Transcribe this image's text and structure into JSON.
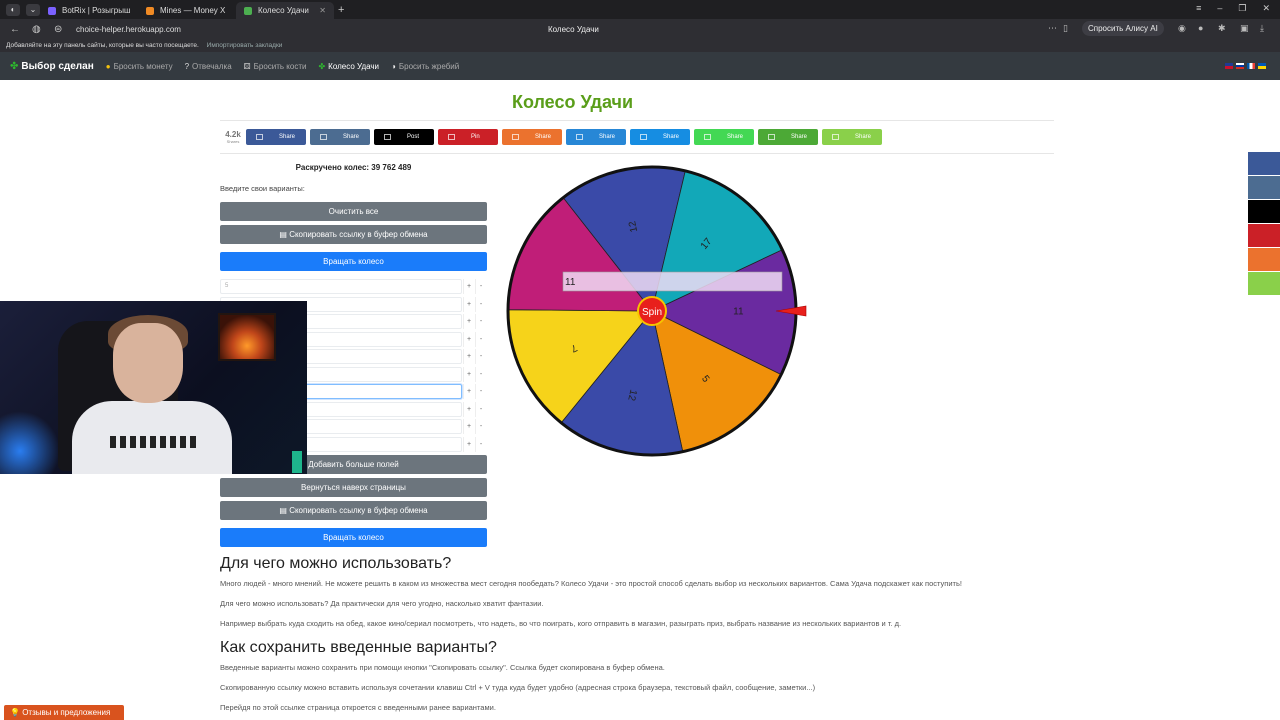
{
  "browser": {
    "tabs": [
      {
        "title": "BotRix | Розыгрыши",
        "color": "#7b61ff"
      },
      {
        "title": "Mines — Money X",
        "color": "#f08a24"
      },
      {
        "title": "Колесо Удачи",
        "color": "#4caf50"
      }
    ],
    "url": "choice-helper.herokuapp.com",
    "page_title": "Колесо Удачи",
    "alice_button": "Спросить Алису AI",
    "bookmarks_hint": "Добавляйте на эту панель сайты, которые вы часто посещаете.",
    "bookmarks_import": "Импортировать закладки"
  },
  "nav": {
    "brand": "Выбор сделан",
    "items": [
      {
        "label": "Бросить монету",
        "icon": "coin-icon"
      },
      {
        "label": "Отвечалка",
        "icon": "question-icon"
      },
      {
        "label": "Бросить кости",
        "icon": "dice-icon"
      },
      {
        "label": "Колесо Удачи",
        "icon": "clover-icon"
      },
      {
        "label": "Бросить жребий",
        "icon": "lot-icon"
      }
    ]
  },
  "page": {
    "title": "Колесо Удачи",
    "share_count": "4.2k",
    "share_count_label": "Shares",
    "share_buttons": [
      {
        "label": "Share",
        "color": "#3b5998"
      },
      {
        "label": "Share",
        "color": "#4c6c91"
      },
      {
        "label": "Post",
        "color": "#000000"
      },
      {
        "label": "Pin",
        "color": "#cb2027"
      },
      {
        "label": "Share",
        "color": "#eb722e"
      },
      {
        "label": "Share",
        "color": "#2787d6"
      },
      {
        "label": "Share",
        "color": "#168de2"
      },
      {
        "label": "Share",
        "color": "#43d854"
      },
      {
        "label": "Share",
        "color": "#4ca936"
      },
      {
        "label": "Share",
        "color": "#8ad04a"
      }
    ],
    "spun_label": "Раскручено колес:",
    "spun_count": "39 762 489",
    "enter_label": "Введите свои варианты:",
    "clear_all": "Очистить все",
    "copy_link": "Скопировать ссылку в буфер обмена",
    "spin_wheel": "Вращать колесо",
    "add_more": "Добавить больше полей",
    "back_to_top": "Вернуться наверх страницы",
    "first_option_value": "5",
    "section1_heading": "Для чего можно использовать?",
    "section1_p1": "Много людей - много мнений. Не можете решить в каком из множества мест сегодня пообедать? Колесо Удачи - это простой способ сделать выбор из нескольких вариантов. Сама Удача подскажет как поступить!",
    "section1_p2": "Для чего можно использовать? Да практически для чего угодно, насколько хватит фантазии.",
    "section1_p3": "Например выбрать куда сходить на обед, какое кино/сериал посмотреть, что надеть, во что поиграть, кого отправить в магазин, разыграть приз, выбрать название из нескольких вариантов и т. д.",
    "section2_heading": "Как сохранить введенные варианты?",
    "section2_p1": "Введенные варианты можно сохранить при помощи кнопки \"Скопировать ссылку\". Ссылка будет скопирована в буфер обмена.",
    "section2_p2": "Скопированную ссылку можно вставить используя сочетании клавиш Ctrl + V туда куда будет удобно (адресная строка браузера, текстовый файл, сообщение, заметки...)",
    "section2_p3": "Перейдя по этой ссылке страница откроется с введенными ранее вариантами.",
    "feedback": "Отзывы и предложения"
  },
  "wheel": {
    "result_value": "11",
    "spin_label": "Spin",
    "segments": [
      {
        "label": "11",
        "color": "#6a2aa0"
      },
      {
        "label": "5",
        "color": "#f0900a"
      },
      {
        "label": "12",
        "color": "#3a4aa8"
      },
      {
        "label": "7",
        "color": "#f6d31a"
      },
      {
        "label": "",
        "color": "#c01e78"
      },
      {
        "label": "12",
        "color": "#3a4aa8"
      },
      {
        "label": "17",
        "color": "#12a8b8"
      }
    ]
  },
  "right_share": [
    {
      "label": "fac",
      "color": "#3b5998"
    },
    {
      "label": "vk",
      "color": "#4c6c91"
    },
    {
      "label": "x",
      "color": "#000000"
    },
    {
      "label": "p",
      "color": "#cb2027"
    },
    {
      "label": "od",
      "color": "#eb722e"
    },
    {
      "label": "sh",
      "color": "#8ad04a"
    }
  ]
}
